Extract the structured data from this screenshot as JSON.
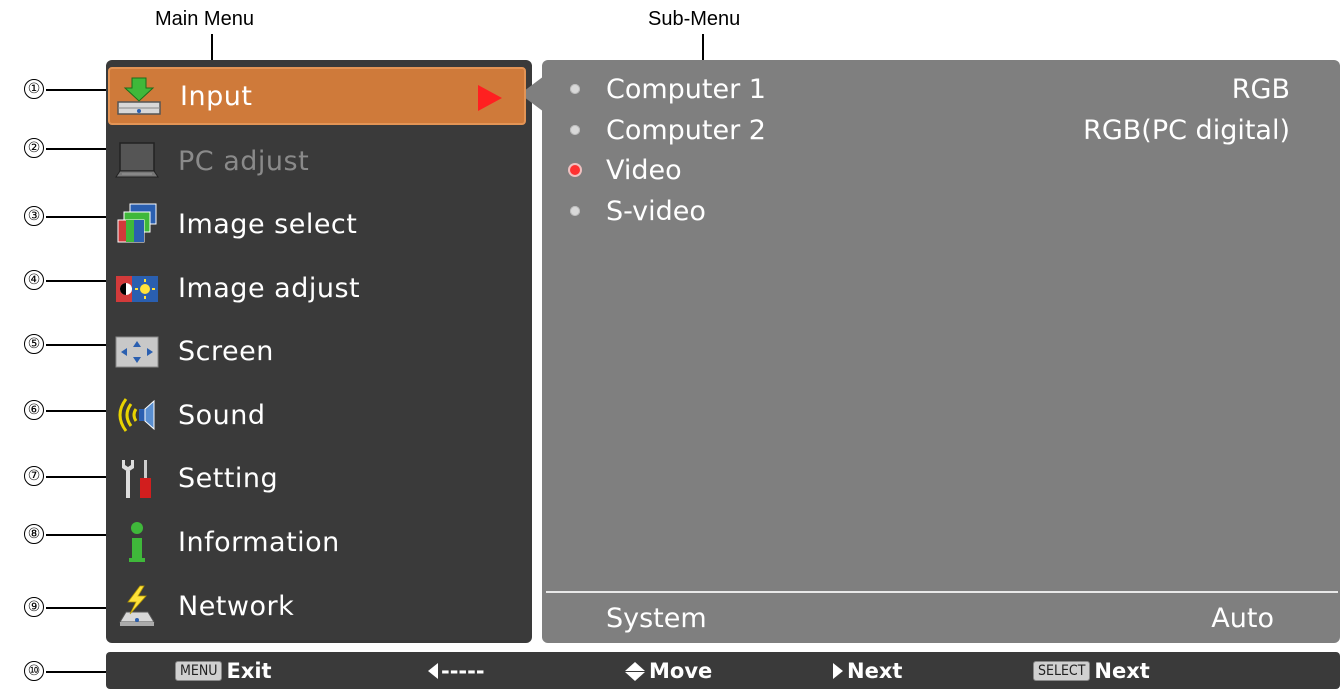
{
  "callouts": {
    "main_menu": "Main Menu",
    "sub_menu": "Sub-Menu",
    "numbers": [
      "①",
      "②",
      "③",
      "④",
      "⑤",
      "⑥",
      "⑦",
      "⑧",
      "⑨",
      "⑩"
    ]
  },
  "main_menu": {
    "items": [
      {
        "label": "Input",
        "icon": "input-icon",
        "selected": true
      },
      {
        "label": "PC adjust",
        "icon": "pc-adjust-icon",
        "disabled": true
      },
      {
        "label": "Image select",
        "icon": "image-select-icon"
      },
      {
        "label": "Image adjust",
        "icon": "image-adjust-icon"
      },
      {
        "label": "Screen",
        "icon": "screen-icon"
      },
      {
        "label": "Sound",
        "icon": "sound-icon"
      },
      {
        "label": "Setting",
        "icon": "setting-icon"
      },
      {
        "label": "Information",
        "icon": "information-icon"
      },
      {
        "label": "Network",
        "icon": "network-icon"
      }
    ],
    "selected_color": "#cf7a3a"
  },
  "sub_menu": {
    "items": [
      {
        "name": "Computer 1",
        "value": "RGB",
        "active": false
      },
      {
        "name": "Computer 2",
        "value": "RGB(PC digital)",
        "active": false
      },
      {
        "name": "Video",
        "value": "",
        "active": true
      },
      {
        "name": "S-video",
        "value": "",
        "active": false
      }
    ],
    "system": {
      "name": "System",
      "value": "Auto"
    }
  },
  "status_bar": {
    "menu_key": "MENU",
    "exit": "Exit",
    "back": "-----",
    "move": "Move",
    "next1": "Next",
    "select_key": "SELECT",
    "next2": "Next"
  }
}
